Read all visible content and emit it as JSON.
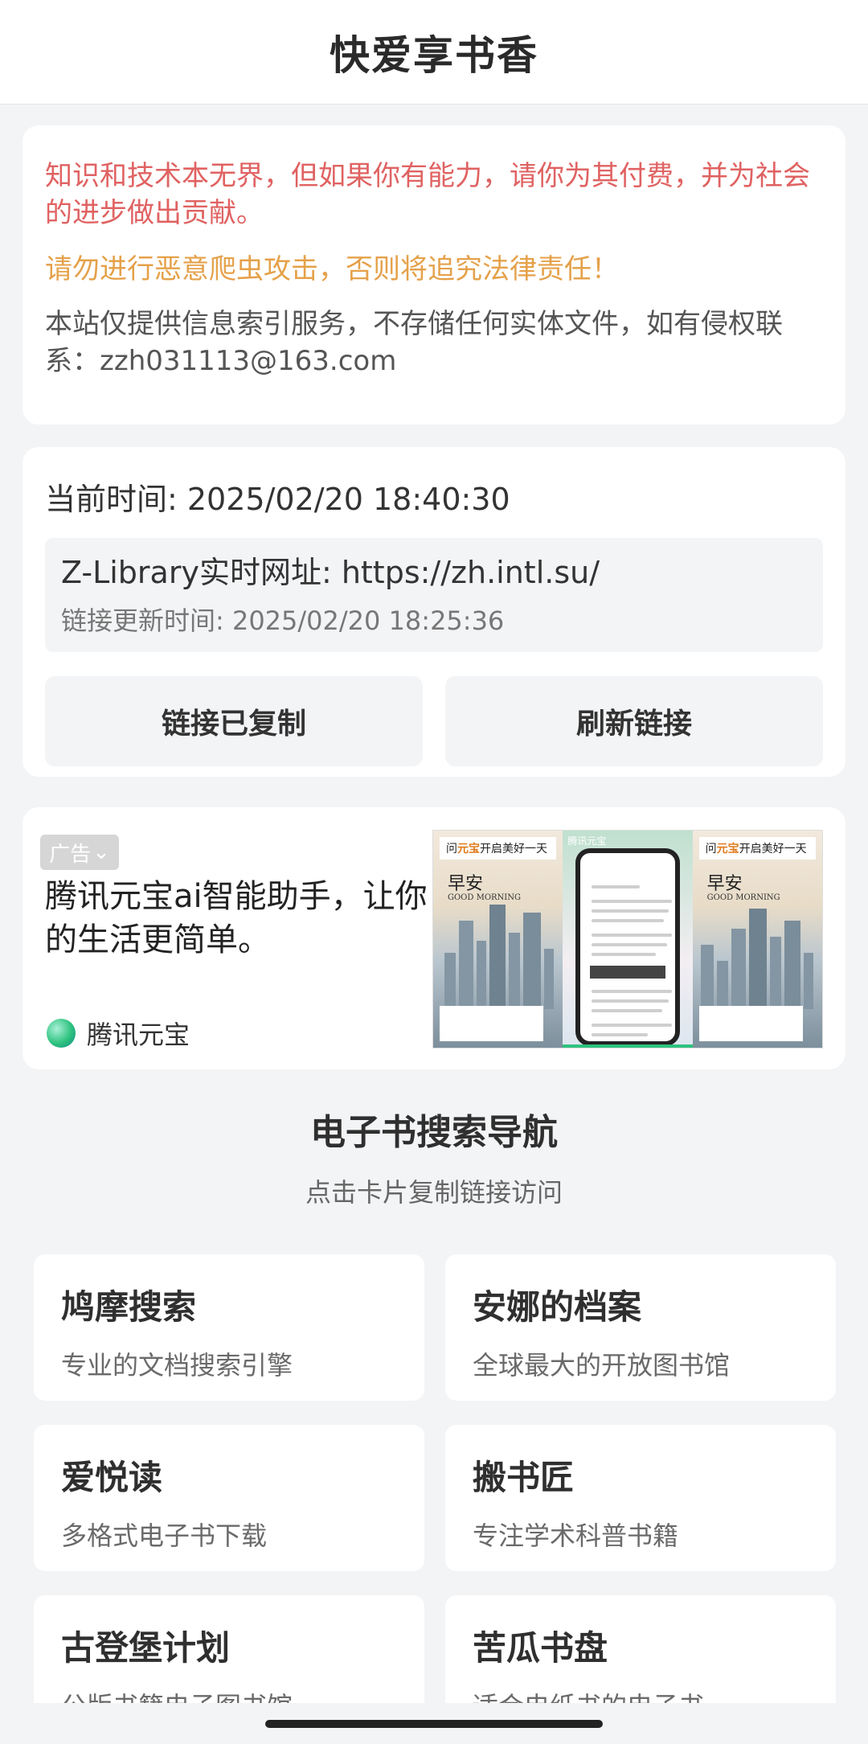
{
  "header": {
    "title": "快爱享书香"
  },
  "notice": {
    "red_text": "知识和技术本无界，但如果你有能力，请你为其付费，并为社会的进步做出贡献。",
    "orange_text": "请勿进行恶意爬虫攻击，否则将追究法律责任！",
    "gray_text": "本站仅提供信息索引服务，不存储任何实体文件，如有侵权联系：zzh031113@163.com"
  },
  "status": {
    "current_time": "当前时间: 2025/02/20 18:40:30",
    "url_line": "Z-Library实时网址: https://zh.intl.su/",
    "update_time": "链接更新时间: 2025/02/20 18:25:36",
    "copy_button": "链接已复制",
    "refresh_button": "刷新链接"
  },
  "ad": {
    "badge": "广告",
    "badge_chevron": "⌄",
    "text": "腾讯元宝ai智能助手，让你的生活更简单。",
    "brand": "腾讯元宝",
    "image": {
      "left_header_pre": "问",
      "left_header_hl": "元宝",
      "left_header_post": "开启美好一天",
      "greeting": "早安",
      "greeting_sub": "GOOD MORNING",
      "phone_app": "腾讯元宝",
      "accent_color": "#2ec27e"
    }
  },
  "nav": {
    "title": "电子书搜索导航",
    "subtitle": "点击卡片复制链接访问",
    "items": [
      {
        "name": "鸠摩搜索",
        "desc": "专业的文档搜索引擎"
      },
      {
        "name": "安娜的档案",
        "desc": "全球最大的开放图书馆"
      },
      {
        "name": "爱悦读",
        "desc": "多格式电子书下载"
      },
      {
        "name": "搬书匠",
        "desc": "专注学术科普书籍"
      },
      {
        "name": "古登堡计划",
        "desc": "公版书籍电子图书馆"
      },
      {
        "name": "苦瓜书盘",
        "desc": "适合电纸书的电子书"
      }
    ]
  }
}
